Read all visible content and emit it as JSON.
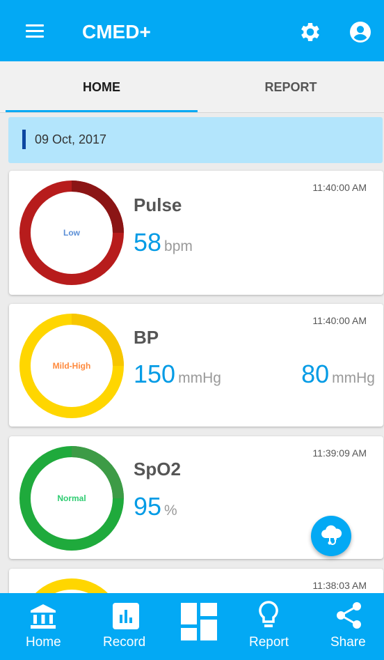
{
  "header": {
    "title": "CMED+",
    "icons": [
      "menu-icon",
      "gear-icon",
      "account-icon"
    ]
  },
  "tabs": [
    {
      "label": "HOME",
      "active": true
    },
    {
      "label": "REPORT",
      "active": false
    }
  ],
  "date": "09 Oct, 2017",
  "cards": [
    {
      "title": "Pulse",
      "time": "11:40:00 AM",
      "status": "Low",
      "value": "58",
      "unit": "bpm",
      "ring_color": "#b71c1c",
      "status_color": "#5b8fd6"
    },
    {
      "title": "BP",
      "time": "11:40:00 AM",
      "status": "Mild-High",
      "value": "150",
      "unit": "mmHg",
      "value2": "80",
      "unit2": "mmHg",
      "ring_color": "#ffd600",
      "status_color": "#ff8a3d"
    },
    {
      "title": "SpO2",
      "time": "11:39:09 AM",
      "status": "Normal",
      "value": "95",
      "unit": "%",
      "ring_color": "#1faa3c",
      "status_color": "#2ecc71"
    },
    {
      "time": "11:38:03 AM",
      "ring_color": "#ffd600"
    }
  ],
  "fab": {
    "icon": "cloud-stethoscope-icon"
  },
  "bottom_nav": [
    {
      "label": "Home",
      "icon": "bank-icon"
    },
    {
      "label": "Record",
      "icon": "bar-chart-icon"
    },
    {
      "label": "",
      "icon": "dashboard-icon"
    },
    {
      "label": "Report",
      "icon": "lightbulb-icon"
    },
    {
      "label": "Share",
      "icon": "share-icon"
    }
  ],
  "colors": {
    "primary": "#03a9f4",
    "accent_text": "#039be5",
    "date_bar": "#b3e5fc"
  }
}
